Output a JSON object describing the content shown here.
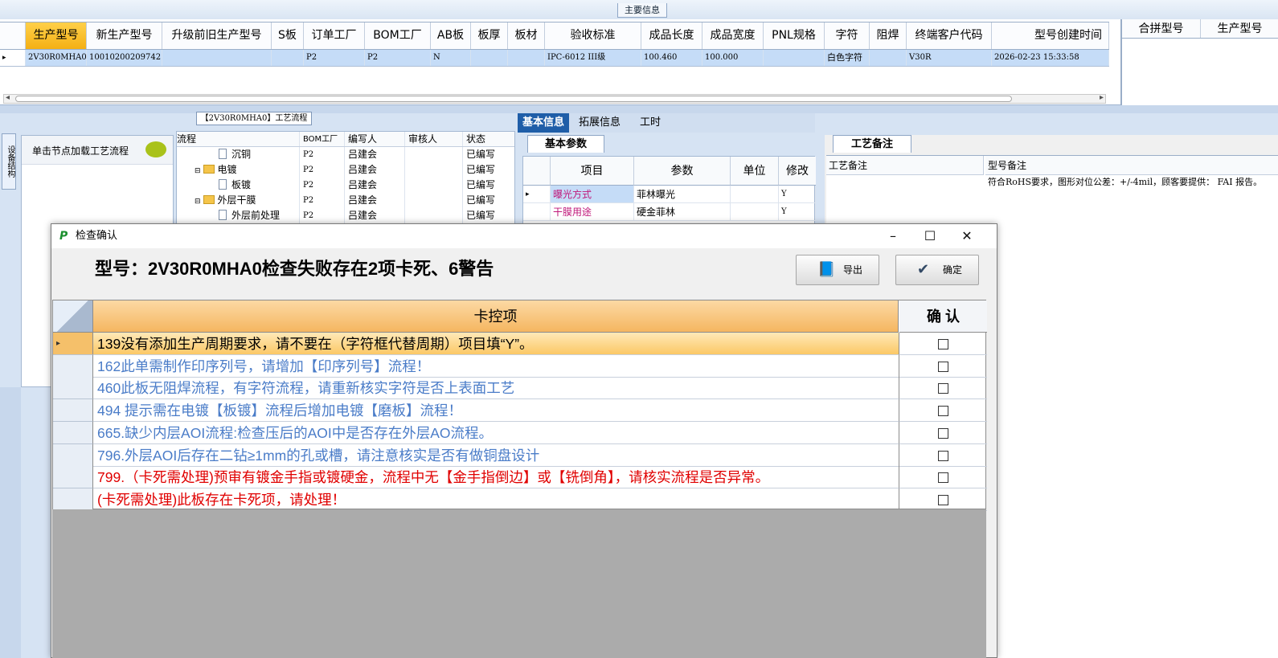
{
  "main_info": {
    "tab_label": "主要信息",
    "columns": [
      "生产型号",
      "新生产型号",
      "升级前旧生产型号",
      "S板",
      "订单工厂",
      "BOM工厂",
      "AB板",
      "板厚",
      "板材",
      "验收标准",
      "成品长度",
      "成品宽度",
      "PNL规格",
      "字符",
      "阻焊",
      "终端客户代码",
      "型号创建时间"
    ],
    "row": {
      "model": "2V30R0MHA0",
      "new_model": "10010200209742",
      "old_model": "",
      "s_board": "",
      "order_factory": "P2",
      "bom_factory": "P2",
      "ab_board": "N",
      "thickness": "",
      "material": "",
      "acceptance": "IPC-6012 III级",
      "length": "100.460",
      "width": "100.000",
      "pnl": "",
      "char": "白色字符",
      "solder_mask": "",
      "customer_code": "V30R",
      "created": "2026-02-23 15:33:58"
    },
    "merge_columns": [
      "合拼型号",
      "生产型号"
    ]
  },
  "flow": {
    "caption": "【2V30R0MHA0】工艺流程",
    "vertical_tab": "设备结构",
    "load_hint": "单击节点加载工艺流程",
    "columns": [
      "流程",
      "BOM工厂",
      "编写人",
      "审核人",
      "状态"
    ],
    "rows": [
      {
        "name": "沉铜",
        "bom": "P2",
        "writer": "吕建会",
        "reviewer": "",
        "state": "已编写"
      },
      {
        "name": "电镀",
        "bom": "P2",
        "writer": "吕建会",
        "reviewer": "",
        "state": "已编写"
      },
      {
        "name": "板镀",
        "bom": "P2",
        "writer": "吕建会",
        "reviewer": "",
        "state": "已编写"
      },
      {
        "name": "外层干膜",
        "bom": "P2",
        "writer": "吕建会",
        "reviewer": "",
        "state": "已编写"
      },
      {
        "name": "外层前处理",
        "bom": "P2",
        "writer": "吕建会",
        "reviewer": "",
        "state": "已编写"
      }
    ]
  },
  "detail_tabs": [
    "基本信息",
    "拓展信息",
    "工时"
  ],
  "base_params": {
    "tab_label": "基本参数",
    "columns": [
      "项目",
      "参数",
      "单位",
      "修改"
    ],
    "rows": [
      {
        "item": "曝光方式",
        "param": "菲林曝光",
        "unit": "",
        "mod": "Y"
      },
      {
        "item": "干膜用途",
        "param": "硬金菲林",
        "unit": "",
        "mod": "Y"
      }
    ]
  },
  "process_note": {
    "tab_label": "工艺备注",
    "col_a": "工艺备注",
    "col_b": "型号备注",
    "model_note": "符合RoHS要求，图形对位公差：+/-4mil，顾客要提供： FAI 报告。"
  },
  "dialog": {
    "title": "检查确认",
    "headline": "型号：2V30R0MHA0检查失败存在2项卡死、6警告",
    "export_label": "导出",
    "ok_label": "确定",
    "col_item": "卡控项",
    "col_confirm": "确 认",
    "colors": {
      "black": "#000000",
      "warn": "#4a7cc8",
      "block": "#e00000"
    },
    "items": [
      {
        "text": "139没有添加生产周期要求，请不要在（字符框代替周期）项目填“Y”。",
        "level": "black",
        "selected": true
      },
      {
        "text": "162此单需制作印序列号，请增加【印序列号】流程！",
        "level": "warn"
      },
      {
        "text": "460此板无阻焊流程，有字符流程，请重新核实字符是否上表面工艺",
        "level": "warn"
      },
      {
        "text": "494 提示需在电镀【板镀】流程后增加电镀【磨板】流程！",
        "level": "warn"
      },
      {
        "text": "665.缺少内层AOI流程:检查压后的AOI中是否存在外层AO流程。",
        "level": "warn"
      },
      {
        "text": "796.外层AOI后存在二钻≥1mm的孔或槽，请注意核实是否有做铜盘设计",
        "level": "warn"
      },
      {
        "text": "799.（卡死需处理)预审有镀金手指或镀硬金，流程中无【金手指倒边】或【铣倒角】，请核实流程是否异常。",
        "level": "block"
      },
      {
        "text": "(卡死需处理)此板存在卡死项，请处理！",
        "level": "block"
      }
    ]
  }
}
